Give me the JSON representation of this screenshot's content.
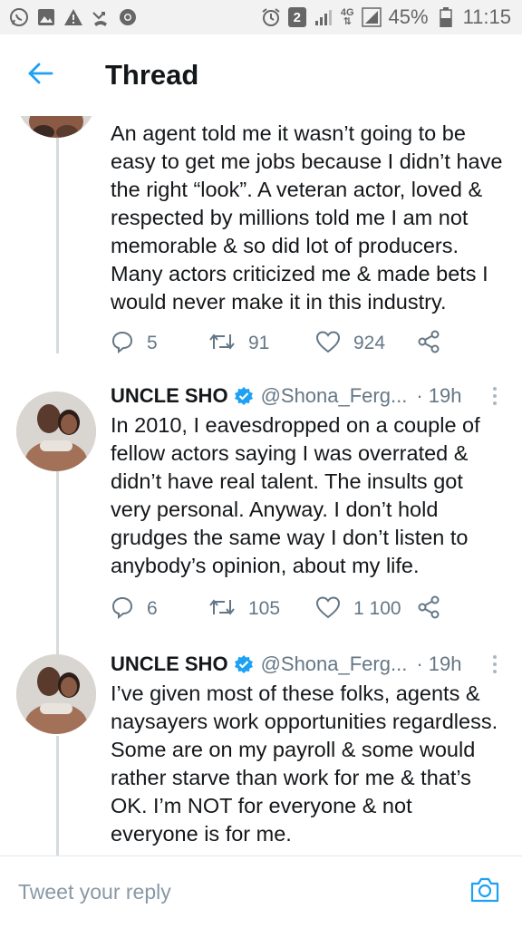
{
  "status_bar": {
    "badge_count": "2",
    "network": "4G",
    "battery": "45%",
    "time": "11:15",
    "icons": [
      "whatsapp-icon",
      "gallery-icon",
      "warning-icon",
      "missed-call-icon",
      "chrome-icon",
      "alarm-icon",
      "signal-icon",
      "battery-icon"
    ]
  },
  "header": {
    "title": "Thread",
    "back_icon": "back-arrow-icon"
  },
  "tweets": [
    {
      "text": "An agent told me it wasn’t going to be easy to get me jobs because I didn’t have the right “look”.  A veteran actor, loved & respected by millions told me I am not memorable & so did lot of producers. Many actors criticized me & made bets I would never make it in this industry.",
      "replies": "5",
      "retweets": "91",
      "likes": "924"
    },
    {
      "name": "UNCLE SHO",
      "handle": "@Shona_Ferg...",
      "time": "· 19h",
      "text": "In 2010, I eavesdropped on a couple of fellow actors saying I was overrated & didn’t have real talent. The insults got very personal. Anyway. I don’t hold grudges the same way I don’t listen to anybody’s opinion, about my life.",
      "replies": "6",
      "retweets": "105",
      "likes": "1 100"
    },
    {
      "name": "UNCLE SHO",
      "handle": "@Shona_Ferg...",
      "time": "· 19h",
      "text": "I’ve given most of these folks, agents & naysayers work opportunities regardless. Some are on my payroll & some would rather starve than work for me & that’s OK. I’m NOT for everyone & not everyone is for me."
    }
  ],
  "reply_bar": {
    "placeholder": "Tweet your reply",
    "camera_icon": "camera-icon"
  },
  "colors": {
    "accent": "#1da1f2",
    "icon_gray": "#657786",
    "thread_line": "#d6dbdf"
  }
}
